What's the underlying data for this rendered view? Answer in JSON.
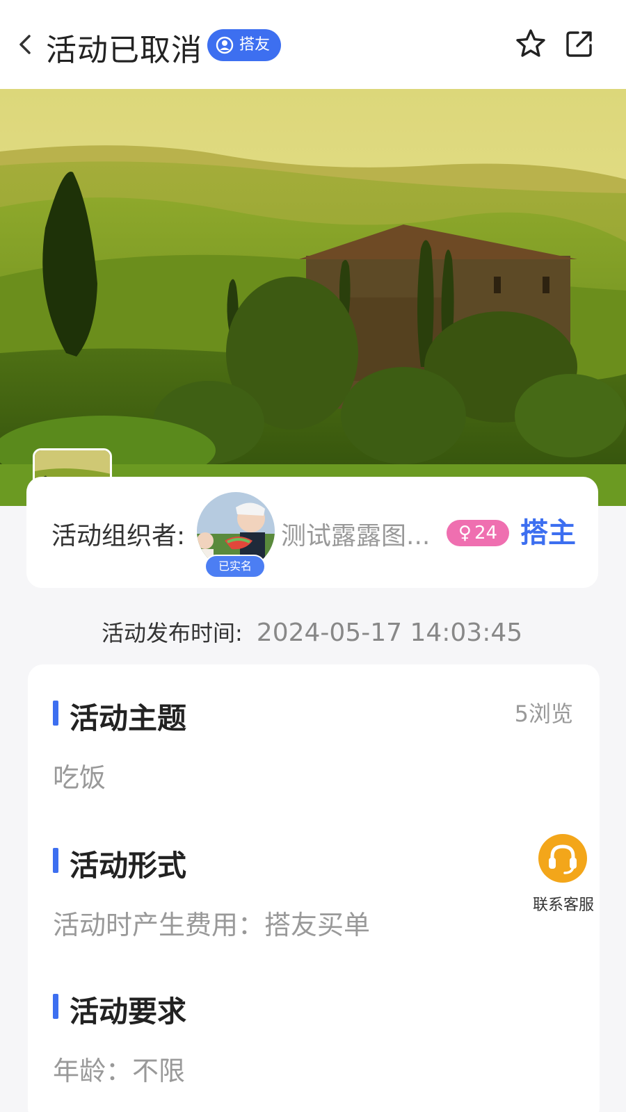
{
  "header": {
    "title": "活动已取消",
    "badge": "搭友"
  },
  "organizer": {
    "label": "活动组织者:",
    "verified": "已实名",
    "name": "测试露露图...",
    "gender_symbol": "♀",
    "age": "24",
    "role": "搭主"
  },
  "publish": {
    "label": "活动发布时间:",
    "value": "2024-05-17 14:03:45"
  },
  "sections": {
    "theme_title": "活动主题",
    "views": "5浏览",
    "theme_value": "吃饭",
    "form_title": "活动形式",
    "form_value": "活动时产生费用：搭友买单",
    "req_title": "活动要求",
    "req_value": "年龄：不限"
  },
  "service": {
    "label": "联系客服"
  },
  "colors": {
    "accent": "#3d6ff0",
    "gender_pink": "#ef6fb0",
    "service_orange": "#f3a61a"
  }
}
